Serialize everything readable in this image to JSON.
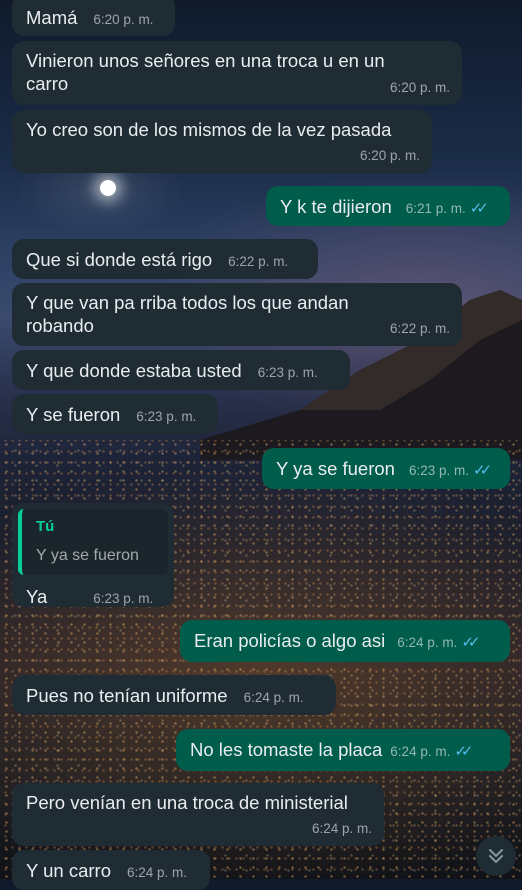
{
  "messages": [
    {
      "text": "Mamá",
      "time": "6:20 p. m."
    },
    {
      "text": "Vinieron unos señores en una troca u en un carro",
      "time": "6:20 p. m."
    },
    {
      "text": "Yo creo son de los mismos de la vez pasada",
      "time": "6:20 p. m."
    },
    {
      "text": "Y k te dijieron",
      "time": "6:21 p. m.",
      "ticks": "✓✓"
    },
    {
      "text": "Que si donde está rigo",
      "time": "6:22 p. m."
    },
    {
      "text": "Y que van pa rriba todos los que andan robando",
      "time": "6:22 p. m."
    },
    {
      "text": "Y que donde estaba usted",
      "time": "6:23 p. m."
    },
    {
      "text": "Y se fueron",
      "time": "6:23 p. m."
    },
    {
      "text": "Y ya se fueron",
      "time": "6:23 p. m.",
      "ticks": "✓✓"
    },
    {
      "text": "Ya",
      "time": "6:23 p. m.",
      "reply": {
        "author": "Tú",
        "text": "Y ya se fueron"
      }
    },
    {
      "text": "Eran policías o algo asi",
      "time": "6:24 p. m.",
      "ticks": "✓✓"
    },
    {
      "text": "Pues no tenían uniforme",
      "time": "6:24 p. m."
    },
    {
      "text": "No les tomaste la placa",
      "time": "6:24 p. m.",
      "ticks": "✓✓"
    },
    {
      "text": "Pero venían en una troca de ministerial",
      "time": "6:24 p. m."
    },
    {
      "text": "Y un carro",
      "time": "6:24 p. m."
    }
  ],
  "colors": {
    "incoming": "#1f2c34",
    "outgoing": "#005c4b",
    "ticks": "#53bdeb",
    "reply_accent": "#06cf9c"
  },
  "scroll_icon": "double-chevron-down-icon"
}
